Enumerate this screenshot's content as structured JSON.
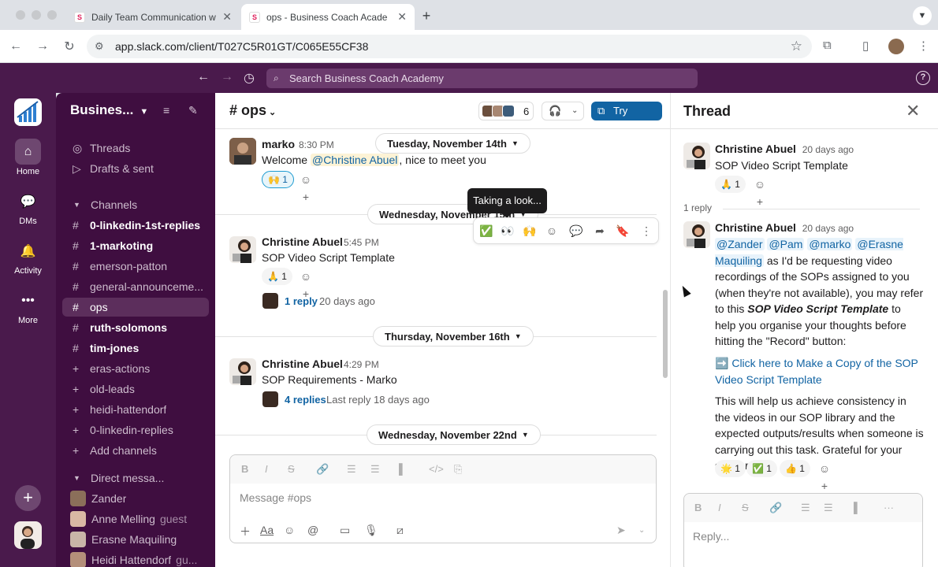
{
  "browser": {
    "tabs": [
      {
        "title": "Daily Team Communication w",
        "active": false
      },
      {
        "title": "ops - Business Coach Acade",
        "active": true
      }
    ],
    "url": "app.slack.com/client/T027C5R01GT/C065E55CF38"
  },
  "topbar": {
    "search_placeholder": "Search Business Coach Academy"
  },
  "rail": {
    "items": [
      {
        "label": "Home",
        "icon": "home-icon"
      },
      {
        "label": "DMs",
        "icon": "dms-icon"
      },
      {
        "label": "Activity",
        "icon": "bell-icon"
      },
      {
        "label": "More",
        "icon": "more-icon"
      }
    ]
  },
  "sidebar": {
    "workspace": "Busines...",
    "nav": [
      {
        "label": "Threads"
      },
      {
        "label": "Drafts & sent"
      }
    ],
    "channels_header": "Channels",
    "channels": [
      {
        "label": "0-linkedin-1st-replies",
        "prefix": "#",
        "bold": true
      },
      {
        "label": "1-markoting",
        "prefix": "#",
        "bold": true
      },
      {
        "label": "emerson-patton",
        "prefix": "#",
        "bold": false
      },
      {
        "label": "general-announceme...",
        "prefix": "#",
        "bold": false
      },
      {
        "label": "ops",
        "prefix": "#",
        "bold": false,
        "active": true
      },
      {
        "label": "ruth-solomons",
        "prefix": "#",
        "bold": true
      },
      {
        "label": "tim-jones",
        "prefix": "#",
        "bold": true
      },
      {
        "label": "eras-actions",
        "prefix": "+",
        "bold": false
      },
      {
        "label": "old-leads",
        "prefix": "+",
        "bold": false
      },
      {
        "label": "heidi-hattendorf",
        "prefix": "+",
        "bold": false
      },
      {
        "label": "0-linkedin-replies",
        "prefix": "+",
        "bold": false
      }
    ],
    "add_channels": "Add channels",
    "dm_header": "Direct messa...",
    "dms": [
      {
        "label": "Zander",
        "guest": ""
      },
      {
        "label": "Anne Melling",
        "guest": "guest"
      },
      {
        "label": "Erasne Maquiling",
        "guest": ""
      },
      {
        "label": "Heidi Hattendorf",
        "guest": "gu..."
      }
    ]
  },
  "channel": {
    "name": "ops",
    "member_count": "6",
    "canvas_label": "Try canvas",
    "date_dividers": [
      "Tuesday, November 14th",
      "Wednesday, November 15th",
      "Thursday, November 16th",
      "Wednesday, November 22nd"
    ],
    "messages": [
      {
        "author": "marko",
        "time": "8:30 PM",
        "text_pre": "Welcome ",
        "mention": "@Christine Abuel",
        "text_post": ", nice to meet you",
        "reaction": {
          "emoji": "🙌",
          "count": "1"
        }
      },
      {
        "author": "Christine Abuel",
        "time": "5:45 PM",
        "text": "SOP Video Script Template",
        "reaction": {
          "emoji": "🙏",
          "count": "1"
        },
        "replies": "1 reply",
        "replies_time": "20 days ago"
      },
      {
        "author": "Christine Abuel",
        "time": "4:29 PM",
        "text": "SOP Requirements - Marko",
        "replies": "4 replies",
        "replies_time": "Last reply 18 days ago"
      }
    ],
    "tooltip": "Taking a look...",
    "hover_toolbar": [
      "check-reaction",
      "eyes-reaction",
      "raised-hands-reaction",
      "add-reaction",
      "reply-in-thread",
      "forward",
      "save",
      "more-actions"
    ],
    "composer_placeholder": "Message #ops"
  },
  "thread": {
    "title": "Thread",
    "parent": {
      "author": "Christine Abuel",
      "time": "20 days ago",
      "text": "SOP Video Script Template",
      "reaction": {
        "emoji": "🙏",
        "count": "1"
      }
    },
    "reply_count": "1 reply",
    "reply": {
      "author": "Christine Abuel",
      "time": "20 days ago",
      "mentions": [
        "@Zander",
        "@Pam",
        "@marko",
        "@Erasne Maquiling"
      ],
      "body1": " as I'd be requesting video recordings of the SOPs assigned to you (when they're not available), you may refer to this ",
      "body1_em": "SOP Video Script Template",
      "body1_post": " to help you organise your thoughts before hitting the \"Record\" button:",
      "link_emoji": "➡️",
      "link_text": "Click here to Make a Copy of the SOP Video Script Template",
      "body2": "This will help us achieve consistency in the videos in our SOP library and the expected outputs/results when someone is carrying out this task. Grateful for your support!",
      "reactions": [
        {
          "emoji": "🌟",
          "count": "1"
        },
        {
          "emoji": "✅",
          "count": "1"
        },
        {
          "emoji": "👍",
          "count": "1"
        }
      ]
    },
    "composer_placeholder": "Reply..."
  },
  "colors": {
    "aubergine": "#3f0e40",
    "rail": "#4a1a4c",
    "link": "#1264a3",
    "canvas_button": "#1264a3"
  }
}
